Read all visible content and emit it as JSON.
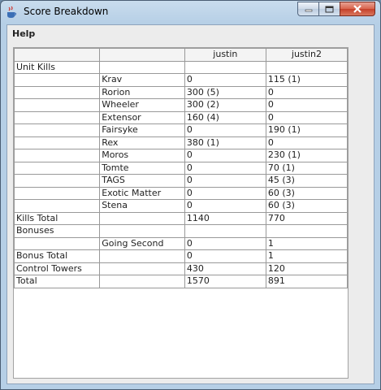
{
  "window": {
    "title": "Score Breakdown",
    "icons": {
      "app": "java-cup-icon",
      "minimize": "minimize-icon",
      "maximize": "maximize-icon",
      "close": "close-icon"
    }
  },
  "menu": {
    "items": [
      "Help"
    ]
  },
  "table": {
    "headers": [
      "",
      "",
      "justin",
      "justin2"
    ],
    "rows": [
      [
        "Unit Kills",
        "",
        "",
        ""
      ],
      [
        "",
        "Krav",
        "0",
        "115 (1)"
      ],
      [
        "",
        "Rorion",
        "300 (5)",
        "0"
      ],
      [
        "",
        "Wheeler",
        "300 (2)",
        "0"
      ],
      [
        "",
        "Extensor",
        "160 (4)",
        "0"
      ],
      [
        "",
        "Fairsyke",
        "0",
        "190 (1)"
      ],
      [
        "",
        "Rex",
        "380 (1)",
        "0"
      ],
      [
        "",
        "Moros",
        "0",
        "230 (1)"
      ],
      [
        "",
        "Tomte",
        "0",
        "70 (1)"
      ],
      [
        "",
        "TAGS",
        "0",
        "45 (3)"
      ],
      [
        "",
        "Exotic Matter",
        "0",
        "60 (3)"
      ],
      [
        "",
        "Stena",
        "0",
        "60 (3)"
      ],
      [
        "Kills Total",
        "",
        "1140",
        "770"
      ],
      [
        "Bonuses",
        "",
        "",
        ""
      ],
      [
        "",
        "Going Second",
        "0",
        "1"
      ],
      [
        "Bonus Total",
        "",
        "0",
        "1"
      ],
      [
        "Control Towers",
        "",
        "430",
        "120"
      ],
      [
        "Total",
        "",
        "1570",
        "891"
      ]
    ]
  }
}
